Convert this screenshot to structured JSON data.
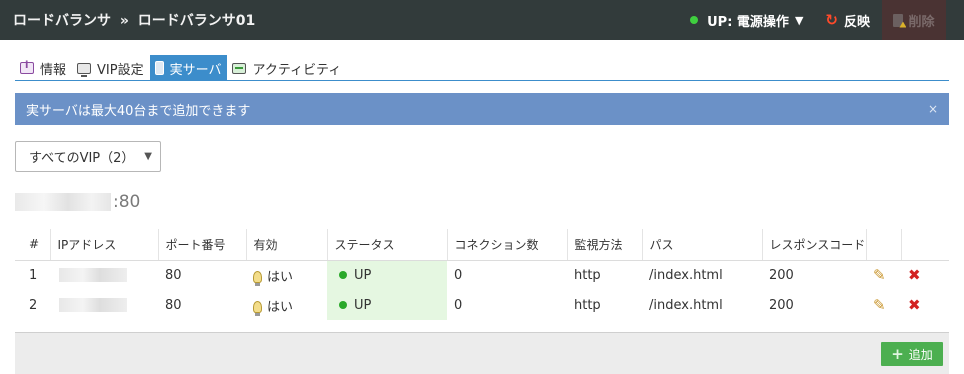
{
  "header": {
    "breadcrumb_root": "ロードバランサ",
    "breadcrumb_sep": "»",
    "breadcrumb_current": "ロードバランサ01",
    "power_label": "UP: 電源操作",
    "power_caret": "▼",
    "reflect_label": "反映",
    "delete_label": "削除",
    "status_color": "#3fcf3f"
  },
  "tabs": [
    {
      "label": "情報",
      "icon": "info-icon"
    },
    {
      "label": "VIP設定",
      "icon": "monitor-icon"
    },
    {
      "label": "実サーバ",
      "icon": "server-icon",
      "active": true
    },
    {
      "label": "アクティビティ",
      "icon": "activity-icon"
    }
  ],
  "alert": {
    "message": "実サーバは最大40台まで追加できます",
    "close": "×"
  },
  "vip_filter": {
    "selected": "すべてのVIP（2）",
    "caret": "▼"
  },
  "vip_group": {
    "port_suffix": ":80"
  },
  "table": {
    "columns": [
      "#",
      "IPアドレス",
      "ポート番号",
      "有効",
      "ステータス",
      "コネクション数",
      "監視方法",
      "パス",
      "レスポンスコード"
    ],
    "rows": [
      {
        "index": "1",
        "port": "80",
        "enabled": "はい",
        "status": "UP",
        "connections": "0",
        "method": "http",
        "path": "/index.html",
        "code": "200"
      },
      {
        "index": "2",
        "port": "80",
        "enabled": "はい",
        "status": "UP",
        "connections": "0",
        "method": "http",
        "path": "/index.html",
        "code": "200"
      }
    ],
    "edit_icon": "✎",
    "delete_icon": "✖"
  },
  "footer": {
    "add_label": "追加",
    "add_icon": "+"
  }
}
